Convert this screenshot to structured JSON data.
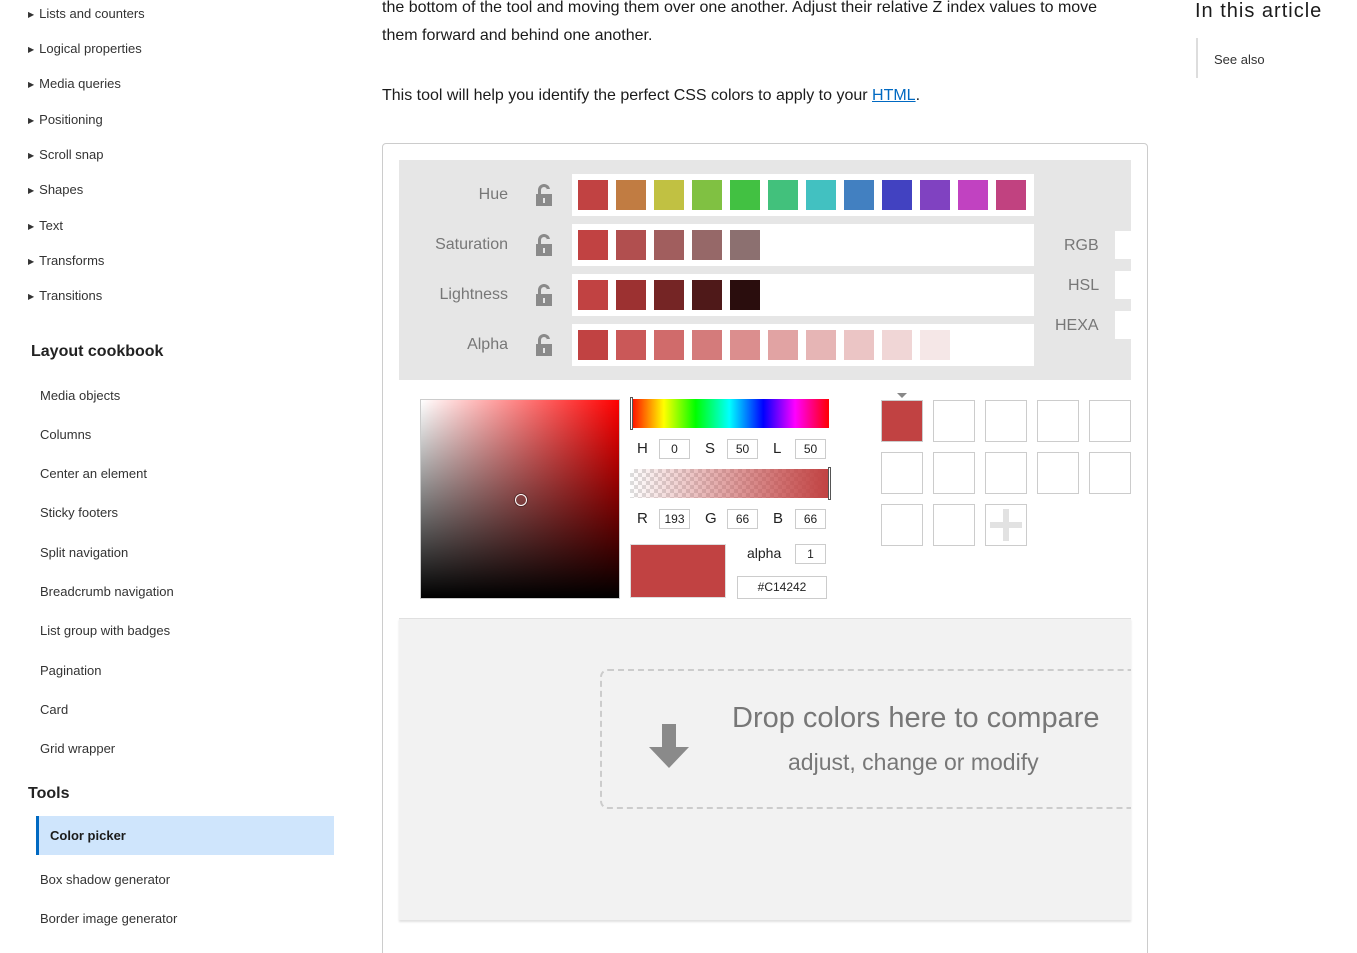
{
  "sidebar": {
    "collapsed_items": [
      "Lists and counters",
      "Logical properties",
      "Media queries",
      "Positioning",
      "Scroll snap",
      "Shapes",
      "Text",
      "Transforms",
      "Transitions"
    ],
    "layout_heading": "Layout cookbook",
    "layout_items": [
      "Media objects",
      "Columns",
      "Center an element",
      "Sticky footers",
      "Split navigation",
      "Breadcrumb navigation",
      "List group with badges",
      "Pagination",
      "Card",
      "Grid wrapper"
    ],
    "tools_heading": "Tools",
    "tools_active": "Color picker",
    "tools_items": [
      "Box shadow generator",
      "Border image generator"
    ]
  },
  "main": {
    "para1": "the bottom of the tool and moving them over one another. Adjust their relative Z index values to move them forward and behind one another.",
    "para2_prefix": "This tool will help you identify the perfect CSS colors to apply to your ",
    "para2_link": "HTML",
    "para2_suffix": "."
  },
  "toc": {
    "title": "In this article",
    "items": [
      "See also"
    ]
  },
  "palette": {
    "rows": [
      {
        "label": "Hue",
        "colors": [
          "#c14242",
          "#c17c42",
          "#c1c142",
          "#80c142",
          "#42c142",
          "#42c17c",
          "#42c1c1",
          "#4280c1",
          "#4242c1",
          "#8042c1",
          "#c142c1",
          "#c14280"
        ]
      },
      {
        "label": "Saturation",
        "colors": [
          "#c14242",
          "#b14f4f",
          "#a15e5e",
          "#966868",
          "#8c7070"
        ]
      },
      {
        "label": "Lightness",
        "colors": [
          "#c14242",
          "#9c3131",
          "#752525",
          "#4f1919",
          "#2a0d0d"
        ]
      },
      {
        "label": "Alpha",
        "colors": [
          "#c14242",
          "#ca5858",
          "#d06b6b",
          "#d47b7b",
          "#db8e8e",
          "#e1a3a3",
          "#e6b5b5",
          "#ebc5c5",
          "#f0d6d6",
          "#f5e7e7"
        ]
      }
    ],
    "formats": [
      "RGB",
      "HSL",
      "HEXA"
    ]
  },
  "picker": {
    "h_label": "H",
    "h": "0",
    "s_label": "S",
    "s": "50",
    "l_label": "L",
    "l": "50",
    "r_label": "R",
    "r": "193",
    "g_label": "G",
    "g": "66",
    "b_label": "B",
    "b": "66",
    "alpha_label": "alpha",
    "alpha": "1",
    "hex": "#C14242",
    "current_color": "#c14242"
  },
  "drop": {
    "title": "Drop colors here to compare",
    "subtitle": "adjust, change or modify"
  }
}
